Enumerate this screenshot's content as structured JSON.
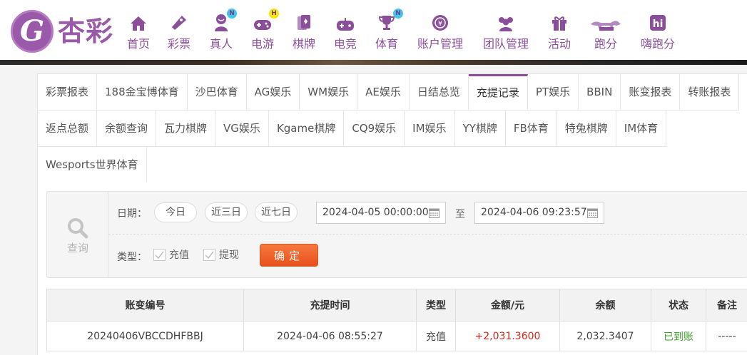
{
  "brand": {
    "logo_text": "杏彩",
    "logo_letter": "G"
  },
  "nav": [
    {
      "label": "首页",
      "icon": "home-icon",
      "badge": ""
    },
    {
      "label": "彩票",
      "icon": "lottery-ticket-icon",
      "badge": ""
    },
    {
      "label": "真人",
      "icon": "live-dealer-icon",
      "badge": "N"
    },
    {
      "label": "电游",
      "icon": "gamepad-icon",
      "badge": "H"
    },
    {
      "label": "棋牌",
      "icon": "cards-icon",
      "badge": ""
    },
    {
      "label": "电竞",
      "icon": "esports-controller-icon",
      "badge": ""
    },
    {
      "label": "体育",
      "icon": "trophy-icon",
      "badge": "N"
    },
    {
      "label": "账户管理",
      "icon": "account-icon",
      "badge": ""
    },
    {
      "label": "团队管理",
      "icon": "team-icon",
      "badge": ""
    },
    {
      "label": "活动",
      "icon": "gift-icon",
      "badge": ""
    },
    {
      "label": "跑分",
      "icon": "running-dog-icon",
      "badge": ""
    },
    {
      "label": "嗨跑分",
      "icon": "hi-icon",
      "badge": ""
    }
  ],
  "tabs": {
    "row1": [
      "彩票报表",
      "188金宝博体育",
      "沙巴体育",
      "AG娱乐",
      "WM娱乐",
      "AE娱乐",
      "日结总览",
      "充提记录",
      "PT娱乐",
      "BBIN",
      "账变报表",
      "转账报表"
    ],
    "row2": [
      "返点总额",
      "余额查询",
      "瓦力棋牌",
      "VG娱乐",
      "Kgame棋牌",
      "CQ9娱乐",
      "IM娱乐",
      "YY棋牌",
      "FB体育",
      "特兔棋牌",
      "IM体育"
    ],
    "row3": [
      "Wesports世界体育"
    ],
    "active": "充提记录"
  },
  "query": {
    "side_label": "查询",
    "date_label": "日期：",
    "quick_dates": [
      "今日",
      "近三日",
      "近七日"
    ],
    "start_date": "2024-04-05 00:00:00",
    "to_label": "至",
    "end_date": "2024-04-06 09:23:57",
    "type_label": "类型：",
    "types": [
      {
        "label": "充值",
        "checked": true
      },
      {
        "label": "提现",
        "checked": true
      }
    ],
    "submit_label": "确定"
  },
  "table": {
    "columns": [
      "账变编号",
      "充提时间",
      "类型",
      "金额/元",
      "余额",
      "状态",
      "备注"
    ],
    "rows": [
      [
        "20240406VBCCDHFBBJ",
        "2024-04-06 08:55:27",
        "充值",
        "+2,031.3600",
        "2,032.3407",
        "已到账",
        "-----"
      ]
    ]
  },
  "colors": {
    "brand": "#8a4e9b",
    "button": "#e8501c",
    "amount": "#d4261a",
    "status_ok": "#3ca129"
  }
}
